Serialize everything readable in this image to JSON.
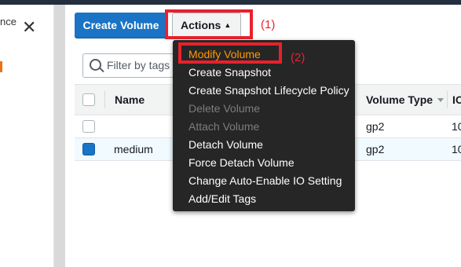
{
  "leftnav": {
    "truncated_text": "nce",
    "close_glyph": "✕"
  },
  "toolbar": {
    "create_label": "Create Volume",
    "actions_label": "Actions",
    "actions_caret": "▲"
  },
  "filter": {
    "placeholder": "Filter by tags a"
  },
  "table": {
    "headers": {
      "name": "Name",
      "volume_type": "Volume Type",
      "iops": "IO"
    },
    "rows": [
      {
        "name": "",
        "volume_type": "gp2",
        "iops": "10",
        "selected": false
      },
      {
        "name": "medium",
        "volume_type": "gp2",
        "iops": "10",
        "selected": true
      }
    ]
  },
  "menu": {
    "items": [
      {
        "label": "Modify Volume",
        "state": "highlight"
      },
      {
        "label": "Create Snapshot",
        "state": "enabled"
      },
      {
        "label": "Create Snapshot Lifecycle Policy",
        "state": "enabled"
      },
      {
        "label": "Delete Volume",
        "state": "disabled"
      },
      {
        "label": "Attach Volume",
        "state": "disabled"
      },
      {
        "label": "Detach Volume",
        "state": "enabled"
      },
      {
        "label": "Force Detach Volume",
        "state": "enabled"
      },
      {
        "label": "Change Auto-Enable IO Setting",
        "state": "enabled"
      },
      {
        "label": "Add/Edit Tags",
        "state": "enabled"
      }
    ]
  },
  "annotations": {
    "label1": "(1)",
    "label2": "(2)",
    "color": "#e8212c"
  },
  "colors": {
    "primary": "#1a73c4",
    "menu_bg": "#262626",
    "menu_highlight": "#ff9900",
    "topbar": "#232f3e"
  }
}
